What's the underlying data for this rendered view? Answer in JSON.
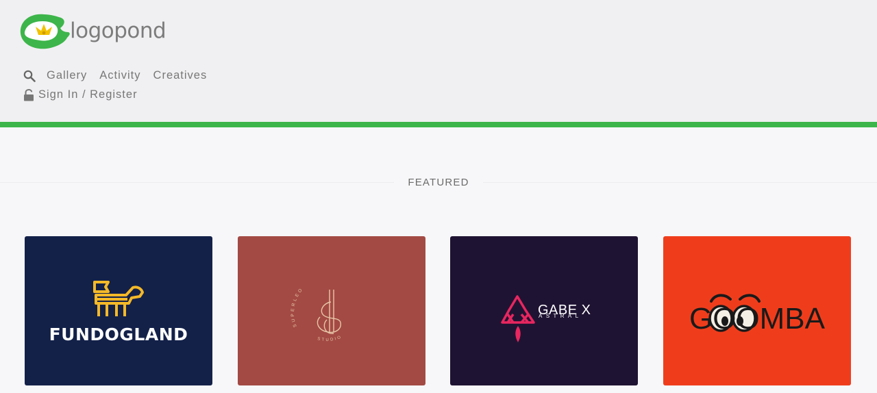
{
  "brand": {
    "name": "logopond",
    "primary_green": "#3db54a",
    "accent_yellow": "#f2c200"
  },
  "nav": {
    "gallery": "Gallery",
    "activity": "Activity",
    "creatives": "Creatives",
    "sign_in": "Sign In / Register"
  },
  "section": {
    "title": "FEATURED"
  },
  "cards": [
    {
      "id": "fundogland",
      "label": "FUNDOGLAND",
      "bg": "#132149",
      "accent": "#f4b928"
    },
    {
      "id": "superleo",
      "arc_text": "SUPERLEO",
      "arc_text_2": "STUDIO",
      "bg": "#a34a44",
      "accent": "#e8c7a8"
    },
    {
      "id": "gabe-x-astral",
      "label": "GABE X",
      "sublabel": "ASTRAL",
      "bg": "#1f1333",
      "accent": "#e8265f"
    },
    {
      "id": "goomba",
      "label": "GOOMBA",
      "bg": "#ef3d1c",
      "accent": "#1a1a1a"
    }
  ],
  "icons": [
    "logopond-lily-icon",
    "search-icon",
    "lock-icon"
  ]
}
